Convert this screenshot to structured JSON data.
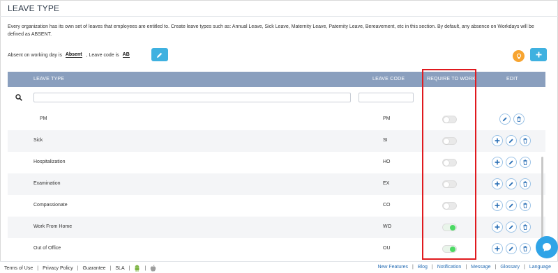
{
  "page": {
    "title": "LEAVE TYPE",
    "description": "Every organization has its own set of leaves that employees are entitled to. Create leave types such as: Annual Leave, Sick Leave, Maternity Leave, Paternity Leave, Bereavement, etc in this section. By default, any absence on Workdays will be defined as ABSENT."
  },
  "absent_settings": {
    "prefix": "Absent on working day is",
    "absent_value": "Absent",
    "middle": ", Leave code is",
    "code_value": "AB"
  },
  "table": {
    "headers": {
      "leave_type": "LEAVE TYPE",
      "leave_code": "LEAVE CODE",
      "require_to_work": "REQUIRE TO WORK",
      "edit": "EDIT"
    },
    "rows": [
      {
        "name": "PM",
        "code": "PM",
        "require_to_work": false,
        "has_add": false,
        "indent": true
      },
      {
        "name": "Sick",
        "code": "SI",
        "require_to_work": false,
        "has_add": true,
        "indent": false
      },
      {
        "name": "Hospitalization",
        "code": "HO",
        "require_to_work": false,
        "has_add": true,
        "indent": false
      },
      {
        "name": "Examination",
        "code": "EX",
        "require_to_work": false,
        "has_add": true,
        "indent": false
      },
      {
        "name": "Compassionate",
        "code": "CO",
        "require_to_work": false,
        "has_add": true,
        "indent": false
      },
      {
        "name": "Work From Home",
        "code": "WO",
        "require_to_work": true,
        "has_add": true,
        "indent": false
      },
      {
        "name": "Out of Office",
        "code": "OU",
        "require_to_work": true,
        "has_add": true,
        "indent": false
      }
    ]
  },
  "footer": {
    "left": [
      "Terms of Use",
      "Privacy Policy",
      "Guarantee",
      "SLA"
    ],
    "right": [
      "New Features",
      "Blog",
      "Notification",
      "Message",
      "Glossary",
      "Language"
    ]
  },
  "colors": {
    "header_bg": "#8a9fbe",
    "accent": "#3fb1e0",
    "highlight": "#e0191e",
    "toggle_on": "#4cd964",
    "link": "#2a6fb5"
  },
  "icons": {
    "edit": "pencil-icon",
    "delete": "trash-icon",
    "add": "plus-icon",
    "search": "search-icon",
    "tip": "lightbulb-icon",
    "chat": "chat-icon",
    "android": "android-icon",
    "apple": "apple-icon"
  }
}
